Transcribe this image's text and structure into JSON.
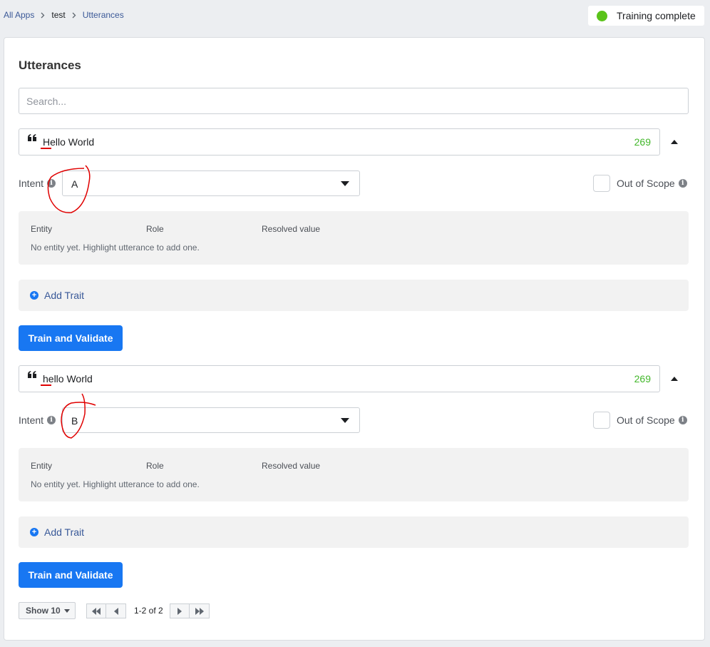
{
  "breadcrumb": {
    "all_apps": "All Apps",
    "app": "test",
    "current": "Utterances"
  },
  "status": {
    "text": "Training complete",
    "color": "#5ac31a"
  },
  "page": {
    "title": "Utterances"
  },
  "search": {
    "placeholder": "Search..."
  },
  "utterances": [
    {
      "text": "Hello World",
      "count": "269",
      "intent_label": "Intent",
      "intent_value": "A",
      "out_of_scope_label": "Out of Scope",
      "entity_headers": {
        "entity": "Entity",
        "role": "Role",
        "resolved": "Resolved value"
      },
      "entity_empty": "No entity yet. Highlight utterance to add one.",
      "add_trait": "Add Trait",
      "train_button": "Train and Validate"
    },
    {
      "text": "hello World",
      "count": "269",
      "intent_label": "Intent",
      "intent_value": "B",
      "out_of_scope_label": "Out of Scope",
      "entity_headers": {
        "entity": "Entity",
        "role": "Role",
        "resolved": "Resolved value"
      },
      "entity_empty": "No entity yet. Highlight utterance to add one.",
      "add_trait": "Add Trait",
      "train_button": "Train and Validate"
    }
  ],
  "pagination": {
    "show": "Show 10",
    "range": "1-2 of 2"
  },
  "icons": {
    "quote": "quote-icon",
    "info": "info-icon",
    "plus": "plus-circle-icon",
    "collapse": "chevron-up-icon",
    "dropdown": "caret-down-icon",
    "first": "double-left-icon",
    "prev": "left-icon",
    "next": "right-icon",
    "last": "double-right-icon"
  },
  "colors": {
    "primary": "#1877f2",
    "count_green": "#42b72a",
    "annotation": "#e00000"
  }
}
